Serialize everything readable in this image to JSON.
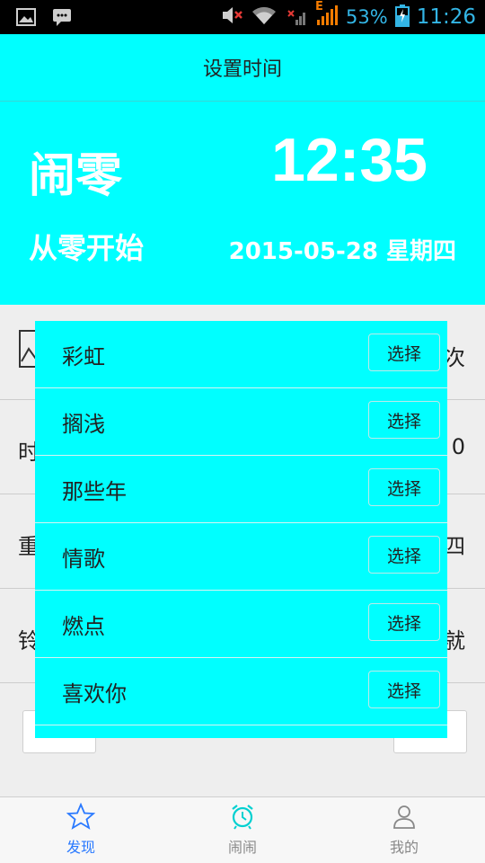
{
  "status_bar": {
    "battery": "53%",
    "time": "11:26",
    "network_label": "E"
  },
  "title_bar": {
    "title": "设置时间"
  },
  "header": {
    "alarm_name": "闹零",
    "alarm_time": "12:35",
    "subtitle": "从零开始",
    "date": "2015-05-28 星期四"
  },
  "background_rows": [
    {
      "left": "",
      "right": "次"
    },
    {
      "left": "时",
      "right": "0"
    },
    {
      "left": "重",
      "right": "四"
    },
    {
      "left": "铃",
      "right": "就"
    }
  ],
  "song_list": {
    "items": [
      {
        "name": "彩虹",
        "button": "选择"
      },
      {
        "name": "搁浅",
        "button": "选择"
      },
      {
        "name": "那些年",
        "button": "选择"
      },
      {
        "name": "情歌",
        "button": "选择"
      },
      {
        "name": "燃点",
        "button": "选择"
      },
      {
        "name": "喜欢你",
        "button": "选择"
      }
    ]
  },
  "bottom_nav": {
    "items": [
      {
        "label": "发现",
        "icon": "star-icon",
        "active": true
      },
      {
        "label": "闹闹",
        "icon": "alarm-clock-icon",
        "active": false
      },
      {
        "label": "我的",
        "icon": "person-icon",
        "active": false
      }
    ]
  },
  "colors": {
    "accent": "#00ffff",
    "nav_active": "#2979ff",
    "nav_inactive": "#888888"
  }
}
